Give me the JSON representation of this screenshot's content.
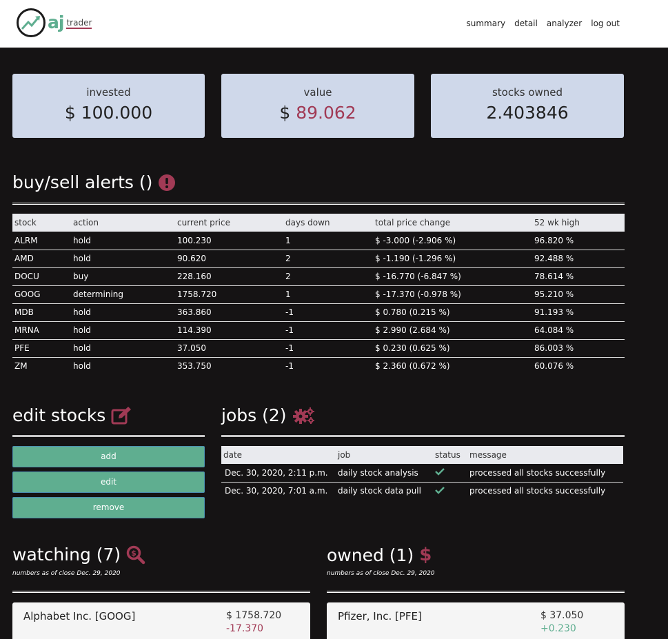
{
  "brand": {
    "aj": "aj",
    "trader": "trader"
  },
  "nav": [
    "summary",
    "detail",
    "analyzer",
    "log out"
  ],
  "cards": {
    "invested": {
      "label": "invested",
      "currency": "$",
      "value": "100.000"
    },
    "value": {
      "label": "value",
      "currency": "$",
      "value": "89.062"
    },
    "stocks_owned": {
      "label": "stocks owned",
      "value": "2.403846"
    }
  },
  "alerts": {
    "title": "buy/sell alerts ()",
    "headers": [
      "stock",
      "action",
      "current price",
      "days down",
      "total price change",
      "52 wk high"
    ],
    "rows": [
      [
        "ALRM",
        "hold",
        "100.230",
        "1",
        "$ -3.000 (-2.906 %)",
        "96.820 %"
      ],
      [
        "AMD",
        "hold",
        "90.620",
        "2",
        "$ -1.190 (-1.296 %)",
        "92.488 %"
      ],
      [
        "DOCU",
        "buy",
        "228.160",
        "2",
        "$ -16.770 (-6.847 %)",
        "78.614 %"
      ],
      [
        "GOOG",
        "determining",
        "1758.720",
        "1",
        "$ -17.370 (-0.978 %)",
        "95.210 %"
      ],
      [
        "MDB",
        "hold",
        "363.860",
        "-1",
        "$ 0.780 (0.215 %)",
        "91.193 %"
      ],
      [
        "MRNA",
        "hold",
        "114.390",
        "-1",
        "$ 2.990 (2.684 %)",
        "64.084 %"
      ],
      [
        "PFE",
        "hold",
        "37.050",
        "-1",
        "$ 0.230 (0.625 %)",
        "86.003 %"
      ],
      [
        "ZM",
        "hold",
        "353.750",
        "-1",
        "$ 2.360 (0.672 %)",
        "60.076 %"
      ]
    ]
  },
  "edit": {
    "title": "edit stocks",
    "buttons": {
      "add": "add",
      "edit": "edit",
      "remove": "remove"
    }
  },
  "jobs": {
    "title": "jobs (2)",
    "headers": [
      "date",
      "job",
      "status",
      "message"
    ],
    "rows": [
      [
        "Dec. 30, 2020, 2:11 p.m.",
        "daily stock analysis",
        "processed all stocks successfully"
      ],
      [
        "Dec. 30, 2020, 7:01 a.m.",
        "daily stock data pull",
        "processed all stocks successfully"
      ]
    ]
  },
  "watching": {
    "title": "watching (7)",
    "subtitle": "numbers as of close Dec. 29, 2020",
    "first": {
      "name": "Alphabet Inc. [GOOG]",
      "price": "$ 1758.720",
      "change": "-17.370"
    }
  },
  "owned": {
    "title": "owned (1)",
    "subtitle": "numbers as of close Dec. 29, 2020",
    "first": {
      "name": "Pfizer, Inc. [PFE]",
      "price": "$ 37.050",
      "change": "+0.230"
    }
  },
  "colors": {
    "accent": "#a13a55",
    "green": "#5fae90",
    "card": "#cfd8ea",
    "bg": "#151314"
  }
}
